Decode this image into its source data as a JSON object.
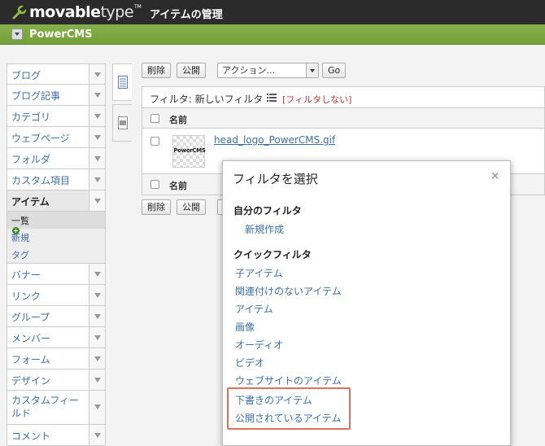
{
  "header": {
    "logo_bold": "movable",
    "logo_light": "type",
    "logo_tm": "TM",
    "page_title": "アイテムの管理"
  },
  "site": {
    "name": "PowerCMS"
  },
  "sidebar": {
    "items": [
      {
        "label": "ブログ"
      },
      {
        "label": "ブログ記事"
      },
      {
        "label": "カテゴリ"
      },
      {
        "label": "ウェブページ"
      },
      {
        "label": "フォルダ"
      },
      {
        "label": "カスタム項目"
      },
      {
        "label": "アイテム"
      },
      {
        "label": "バナー"
      },
      {
        "label": "リンク"
      },
      {
        "label": "グループ"
      },
      {
        "label": "メンバー"
      },
      {
        "label": "フォーム"
      },
      {
        "label": "デザイン"
      },
      {
        "label": "カスタムフィールド"
      },
      {
        "label": "コメント"
      }
    ],
    "sub_items": [
      {
        "label": "一覧"
      },
      {
        "label": "新規"
      },
      {
        "label": "タグ"
      }
    ]
  },
  "toolbar": {
    "delete_label": "削除",
    "publish_label": "公開",
    "action_value": "アクション...",
    "go_label": "Go"
  },
  "filter": {
    "label": "フィルタ: 新しいフィルタ",
    "clear_label": "[フィルタしない]"
  },
  "table": {
    "column_name": "名前",
    "rows": [
      {
        "thumb_text": "PowerCMS",
        "name": "head_logo_PowerCMS.gif"
      }
    ]
  },
  "modal": {
    "title": "フィルタを選択",
    "close": "×",
    "my_filters_heading": "自分のフィルタ",
    "new_filter": "新規作成",
    "quick_filters_heading": "クイックフィルタ",
    "quick_filters": [
      "子アイテム",
      "関連付けのないアイテム",
      "アイテム",
      "画像",
      "オーディオ",
      "ビデオ",
      "ウェブサイトのアイテム",
      "下書きのアイテム",
      "公開されているアイテム"
    ]
  },
  "colors": {
    "header_bg": "#2b2b2b",
    "sitebar_bg": "#7aa83f",
    "link": "#3c6fa4",
    "highlight_border": "#e0705e",
    "clear_filter": "#cc3333"
  }
}
